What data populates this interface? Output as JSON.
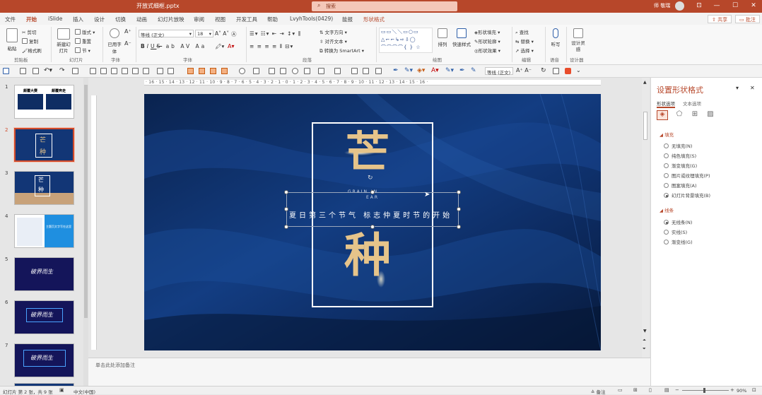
{
  "titlebar": {
    "filename": "开放式细框.pptx",
    "search_placeholder": "搜索",
    "user": "师 敬瑞",
    "minimize": "—",
    "restore": "☐",
    "close": "✕",
    "ribbon_toggle": "⊡"
  },
  "tabs": [
    "文件",
    "开始",
    "iSlide",
    "插入",
    "设计",
    "切换",
    "动画",
    "幻灯片放映",
    "审阅",
    "视图",
    "开发工具",
    "帮助",
    "LvyhTools(0429)",
    "能报",
    "形状格式"
  ],
  "share_button": "共享",
  "comment_button": "批注",
  "ribbon": {
    "clipboard": {
      "paste": "粘贴",
      "cut": "剪切",
      "copy": "复制",
      "format_painter": "格式刷",
      "label": "剪贴板"
    },
    "slides": {
      "new_slide": "新建幻灯片",
      "layout": "版式",
      "reset": "重置",
      "section": "节",
      "label": "幻灯片"
    },
    "font_group": {
      "adopt_font": "已用字体",
      "label": "字体",
      "font_name": "等线 (正文)",
      "font_size": "18"
    },
    "paragraph": {
      "text_direction": "文字方向",
      "align_text": "对齐文本",
      "smartart": "转换为 SmartArt",
      "label": "段落"
    },
    "drawing": {
      "arrange": "排列",
      "quick_styles": "快速样式",
      "fill": "形状填充",
      "outline": "形状轮廓",
      "effects": "形状效果",
      "label": "绘图"
    },
    "editing": {
      "find": "查找",
      "replace": "替换",
      "select": "选择",
      "label": "编辑"
    },
    "voice": {
      "dictate": "听写",
      "label": "语音"
    },
    "designer": {
      "design_ideas": "设计灵感",
      "label": "设计器"
    }
  },
  "qat": {
    "font_field": "等线 (正文)"
  },
  "thumbnails": [
    {
      "num": "1"
    },
    {
      "num": "2"
    },
    {
      "num": "3"
    },
    {
      "num": "4"
    },
    {
      "num": "5"
    },
    {
      "num": "6"
    },
    {
      "num": "7"
    }
  ],
  "thumb_texts": {
    "t1a": "颠覆大赛",
    "t1b": "颠覆奔走",
    "t5": "破界而生",
    "t6": "破界而生",
    "t7": "破界而生",
    "t4": "主题页文字写在这里"
  },
  "ruler_text": "· 16 · 15 · 14 · 13 · 12 · 11 · 10 · 9 · 8 · 7 · 6 · 5 · 4 · 3 · 2 · 1 · 0 · 1 · 2 · 3 · 4 · 5 · 6 · 7 · 8 · 9 · 10 · 11 · 12 · 13 · 14 · 15 · 16 ·",
  "slide": {
    "char_top": "芒",
    "char_bottom": "种",
    "english_line1": "GRAIN IN",
    "english_line2": "EAR",
    "subtitle": "夏日第三个节气 标志仲夏时节的开始"
  },
  "notes_placeholder": "单击此处添加备注",
  "pane": {
    "title": "设置形状格式",
    "tab_shape": "形状选项",
    "tab_text": "文本选项",
    "fill_section": "填充",
    "fill_options": [
      {
        "label": "无填充(N)",
        "checked": false
      },
      {
        "label": "纯色填充(S)",
        "checked": false
      },
      {
        "label": "渐变填充(G)",
        "checked": false
      },
      {
        "label": "图片或纹理填充(P)",
        "checked": false
      },
      {
        "label": "图案填充(A)",
        "checked": false
      },
      {
        "label": "幻灯片背景填充(B)",
        "checked": true
      }
    ],
    "line_section": "线条",
    "line_options": [
      {
        "label": "无线条(N)",
        "checked": true
      },
      {
        "label": "实线(S)",
        "checked": false
      },
      {
        "label": "渐变线(G)",
        "checked": false
      }
    ]
  },
  "status": {
    "slide_info": "幻灯片 第 2 张，共 9 张",
    "language": "中文(中国)",
    "notes": "备注",
    "zoom": "90%"
  },
  "colors": {
    "accent": "#b7472a",
    "slide_bg": "#0d2a5c",
    "gold": "#e6c48a"
  }
}
